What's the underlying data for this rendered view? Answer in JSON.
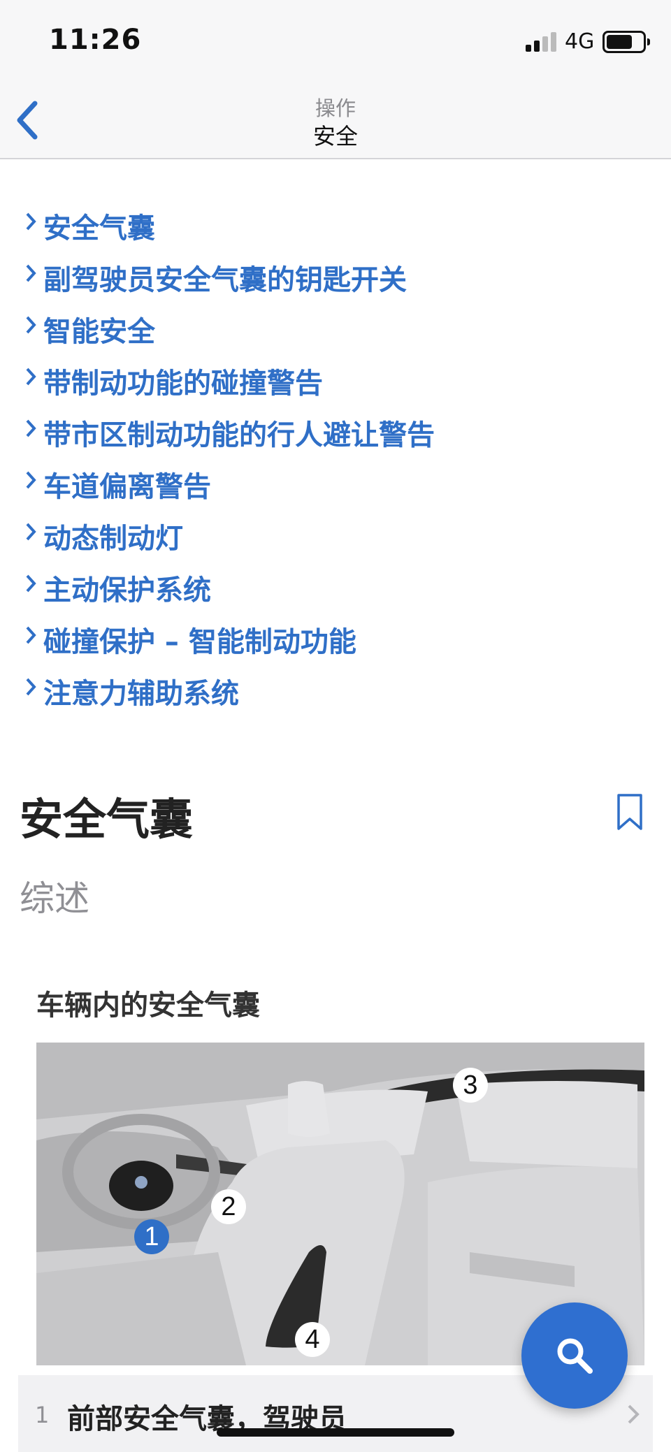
{
  "status_bar": {
    "time": "11:26",
    "network": "4G"
  },
  "nav": {
    "section": "操作",
    "title": "安全",
    "back_icon": "chevron-left-icon"
  },
  "links": [
    {
      "label": "安全气囊"
    },
    {
      "label": "副驾驶员安全气囊的钥匙开关"
    },
    {
      "label": "智能安全"
    },
    {
      "label": "带制动功能的碰撞警告"
    },
    {
      "label": "带市区制动功能的行人避让警告"
    },
    {
      "label": "车道偏离警告"
    },
    {
      "label": "动态制动灯"
    },
    {
      "label": "主动保护系统"
    },
    {
      "label": "碰撞保护 – 智能制动功能"
    },
    {
      "label": "注意力辅助系统"
    }
  ],
  "section": {
    "title": "安全气囊",
    "subtitle": "综述",
    "figure_caption": "车辆内的安全气囊",
    "callouts": [
      "1",
      "2",
      "3",
      "4"
    ]
  },
  "legend": {
    "number": "1",
    "text": "前部安全气囊，驾驶员"
  },
  "colors": {
    "link": "#2f6fc7",
    "accent": "#2f6fd0",
    "background": "#ffffff",
    "bar": "#f7f7f8"
  },
  "icons": {
    "search": "search-icon",
    "bookmark": "bookmark-icon",
    "chevron": "chevron-right-icon"
  }
}
